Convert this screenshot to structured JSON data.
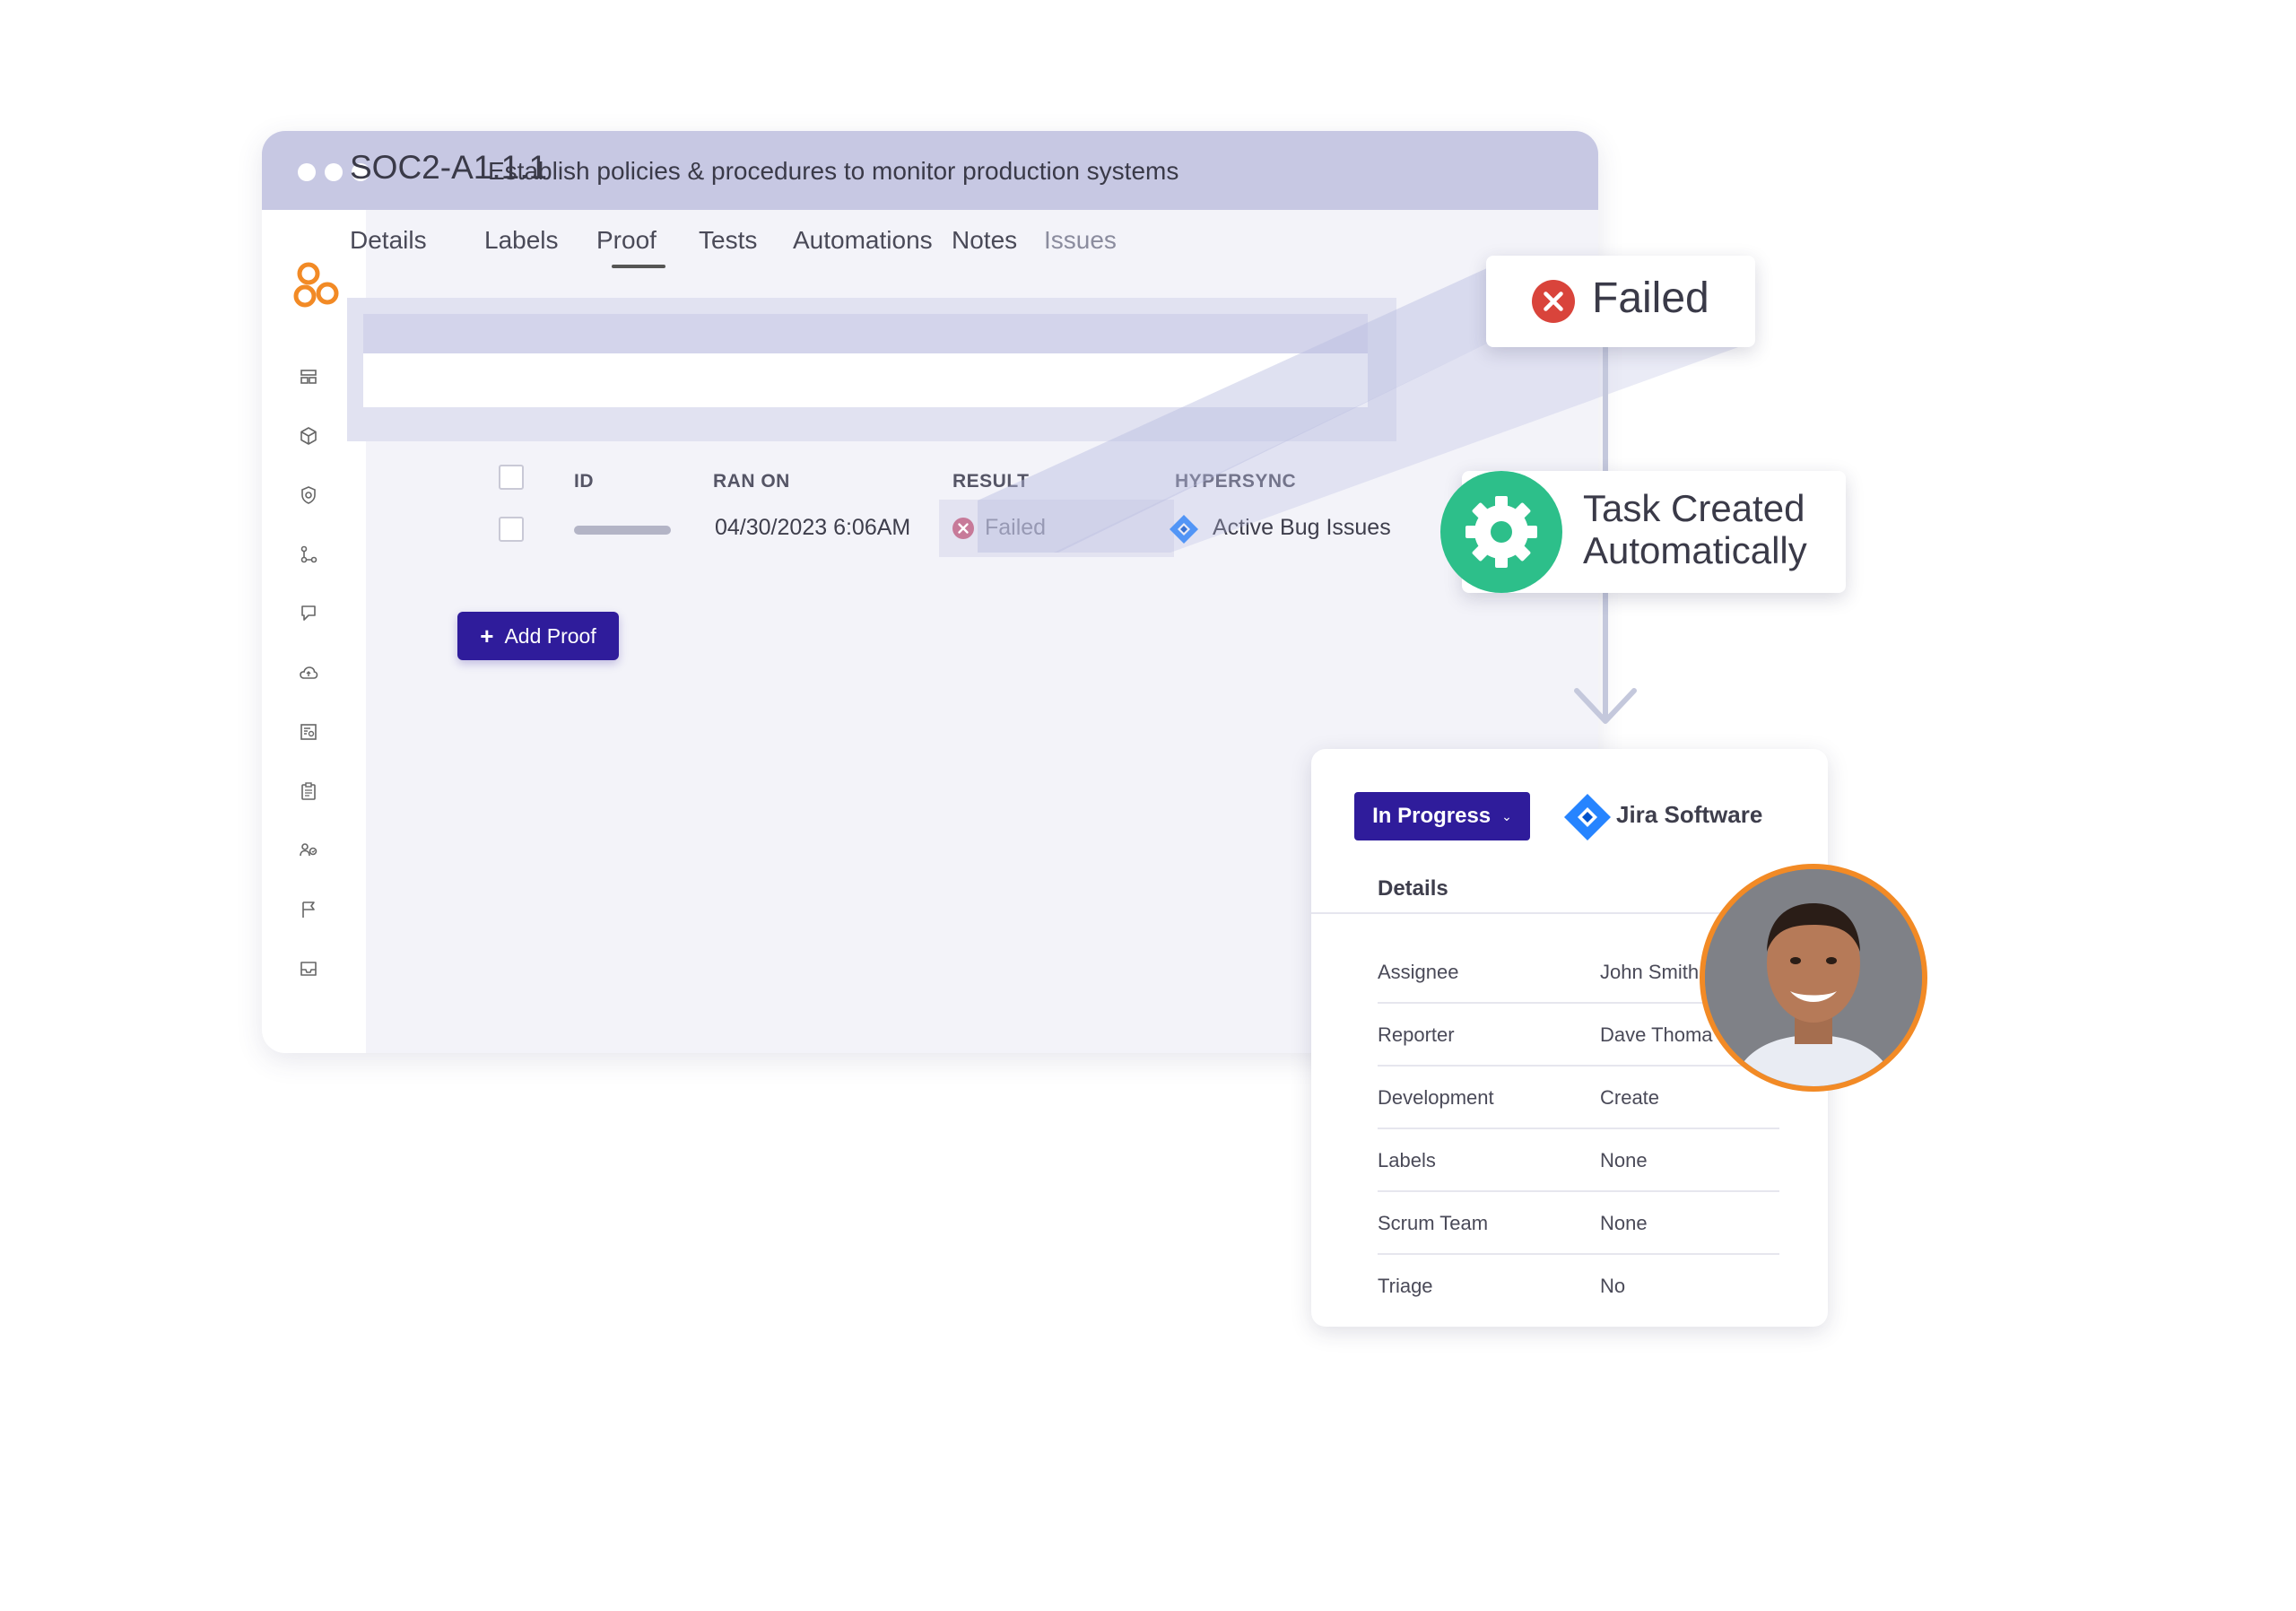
{
  "window": {
    "controls": [
      "close",
      "minimize",
      "maximize"
    ]
  },
  "brand": {
    "logo_icon": "three-circles-logo",
    "accent": "#f28a25"
  },
  "sidebar": {
    "items": [
      {
        "icon": "dashboard-icon"
      },
      {
        "icon": "cube-icon"
      },
      {
        "icon": "shield-icon"
      },
      {
        "icon": "workflow-icon"
      },
      {
        "icon": "bookmark-icon"
      },
      {
        "icon": "cloud-icon"
      },
      {
        "icon": "report-icon"
      },
      {
        "icon": "clipboard-icon"
      },
      {
        "icon": "people-icon"
      },
      {
        "icon": "flag-icon"
      },
      {
        "icon": "inbox-icon"
      }
    ]
  },
  "control": {
    "id": "SOC2-A1.1.1",
    "description": "Establish policies & procedures to monitor production systems"
  },
  "tabs": [
    {
      "label": "Details"
    },
    {
      "label": "Labels"
    },
    {
      "label": "Proof"
    },
    {
      "label": "Tests",
      "active": true
    },
    {
      "label": "Automations"
    },
    {
      "label": "Notes"
    },
    {
      "label": "Issues"
    }
  ],
  "tests_table": {
    "columns": {
      "id": "ID",
      "ran_on": "RAN ON",
      "result": "RESULT",
      "hypersync": "HYPERSYNC"
    },
    "rows": [
      {
        "id": "",
        "ran_on": "04/30/2023 6:06AM",
        "result": "Failed",
        "hypersync": "Active Bug Issues"
      }
    ]
  },
  "add_proof_label": "Add Proof",
  "callouts": {
    "failed": "Failed",
    "task_line1": "Task Created",
    "task_line2": "Automatically"
  },
  "colors": {
    "primary_button": "#2f1c9b",
    "titlebar": "#c7c8e3",
    "failed_red": "#d9443b",
    "success_green": "#2dbf8a",
    "jira_blue": "#2684ff"
  },
  "jira": {
    "status": "In Progress",
    "brand": "Jira Software",
    "details_heading": "Details",
    "fields": [
      {
        "label": "Assignee",
        "value": "John Smith"
      },
      {
        "label": "Reporter",
        "value": "Dave Thoma"
      },
      {
        "label": "Development",
        "value": "Create"
      },
      {
        "label": "Labels",
        "value": "None"
      },
      {
        "label": "Scrum Team",
        "value": "None"
      },
      {
        "label": "Triage",
        "value": "No"
      }
    ]
  }
}
